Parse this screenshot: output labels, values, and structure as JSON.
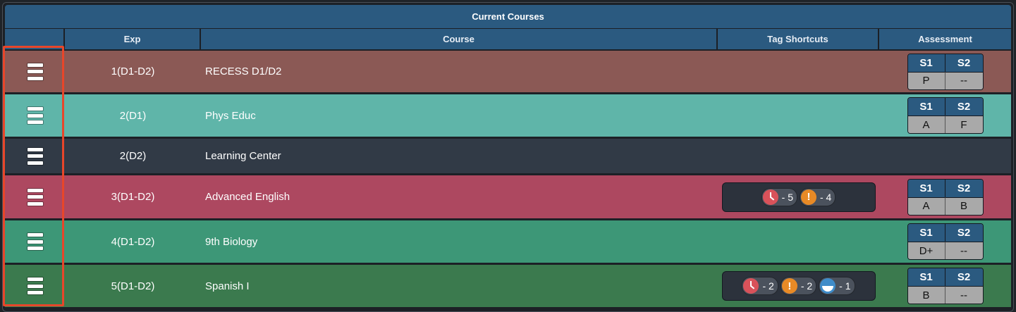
{
  "table": {
    "title": "Current Courses",
    "headers": {
      "menu": "",
      "exp": "Exp",
      "course": "Course",
      "tags": "Tag Shortcuts",
      "assessment": "Assessment"
    },
    "assessment_headers": [
      "S1",
      "S2"
    ]
  },
  "rows": [
    {
      "exp": "1(D1-D2)",
      "course": "RECESS D1/D2",
      "color": "#8b5955",
      "height": 62,
      "tags": [],
      "grades": [
        "P",
        "--"
      ]
    },
    {
      "exp": "2(D1)",
      "course": "Phys Educ",
      "color": "#5fb5a9",
      "height": 63,
      "tags": [],
      "grades": [
        "A",
        "F"
      ]
    },
    {
      "exp": "2(D2)",
      "course": "Learning Center",
      "color": "#313a46",
      "height": 52,
      "tags": [],
      "grades": null
    },
    {
      "exp": "3(D1-D2)",
      "course": "Advanced English",
      "color": "#ad4860",
      "height": 64,
      "tags": [
        {
          "icon": "clock-icon",
          "count": "- 5"
        },
        {
          "icon": "alert-icon",
          "count": "- 4"
        }
      ],
      "grades": [
        "A",
        "B"
      ]
    },
    {
      "exp": "4(D1-D2)",
      "course": "9th Biology",
      "color": "#3d9777",
      "height": 63,
      "tags": [],
      "grades": [
        "D+",
        "--"
      ]
    },
    {
      "exp": "5(D1-D2)",
      "course": "Spanish I",
      "color": "#3b7a4e",
      "height": 63,
      "tags": [
        {
          "icon": "clock-icon",
          "count": "- 2"
        },
        {
          "icon": "alert-icon",
          "count": "- 2"
        },
        {
          "icon": "half-circle-icon",
          "count": "- 1"
        }
      ],
      "grades": [
        "B",
        "--"
      ]
    }
  ],
  "icons": {
    "menu": "hamburger-menu-icon",
    "alert_glyph": "!"
  },
  "colors": {
    "header": "#2b5a80",
    "highlight": "#e8462a"
  }
}
